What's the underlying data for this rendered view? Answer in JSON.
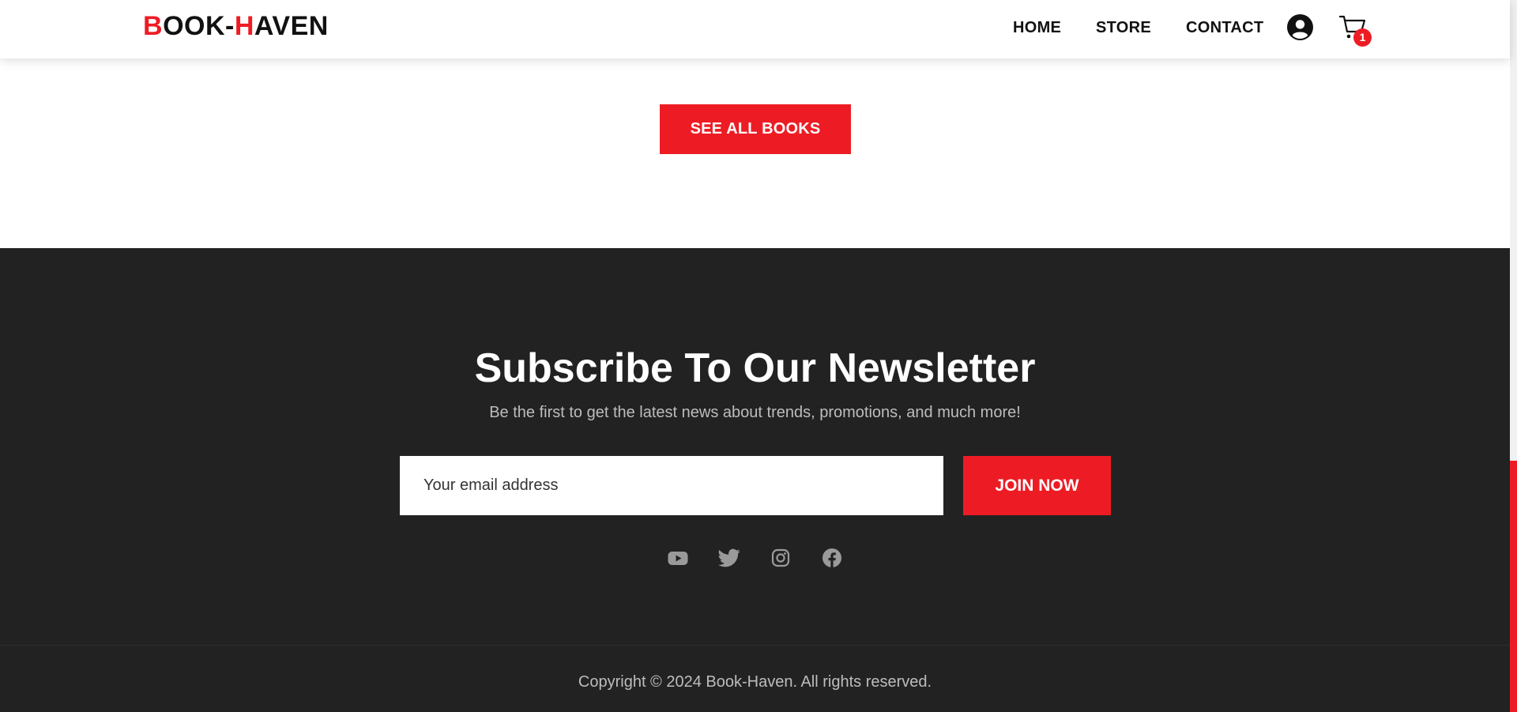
{
  "header": {
    "logo": {
      "part1": "B",
      "part2": "OOK-",
      "part3": "H",
      "part4": "AVEN"
    },
    "nav": {
      "home": "HOME",
      "store": "STORE",
      "contact": "CONTACT"
    },
    "cart_count": "1"
  },
  "main": {
    "see_all_label": "SEE ALL BOOKS"
  },
  "newsletter": {
    "title": "Subscribe To Our Newsletter",
    "subtitle": "Be the first to get the latest news about trends, promotions, and much more!",
    "email_placeholder": "Your email address",
    "join_label": "JOIN NOW",
    "social_icons": [
      "youtube-icon",
      "twitter-icon",
      "instagram-icon",
      "facebook-icon"
    ]
  },
  "footer": {
    "copyright": "Copyright © 2024 Book-Haven. All rights reserved."
  },
  "colors": {
    "accent": "#ed1c24",
    "footer_bg": "#222222",
    "footer_text": "#bdbdbd"
  }
}
